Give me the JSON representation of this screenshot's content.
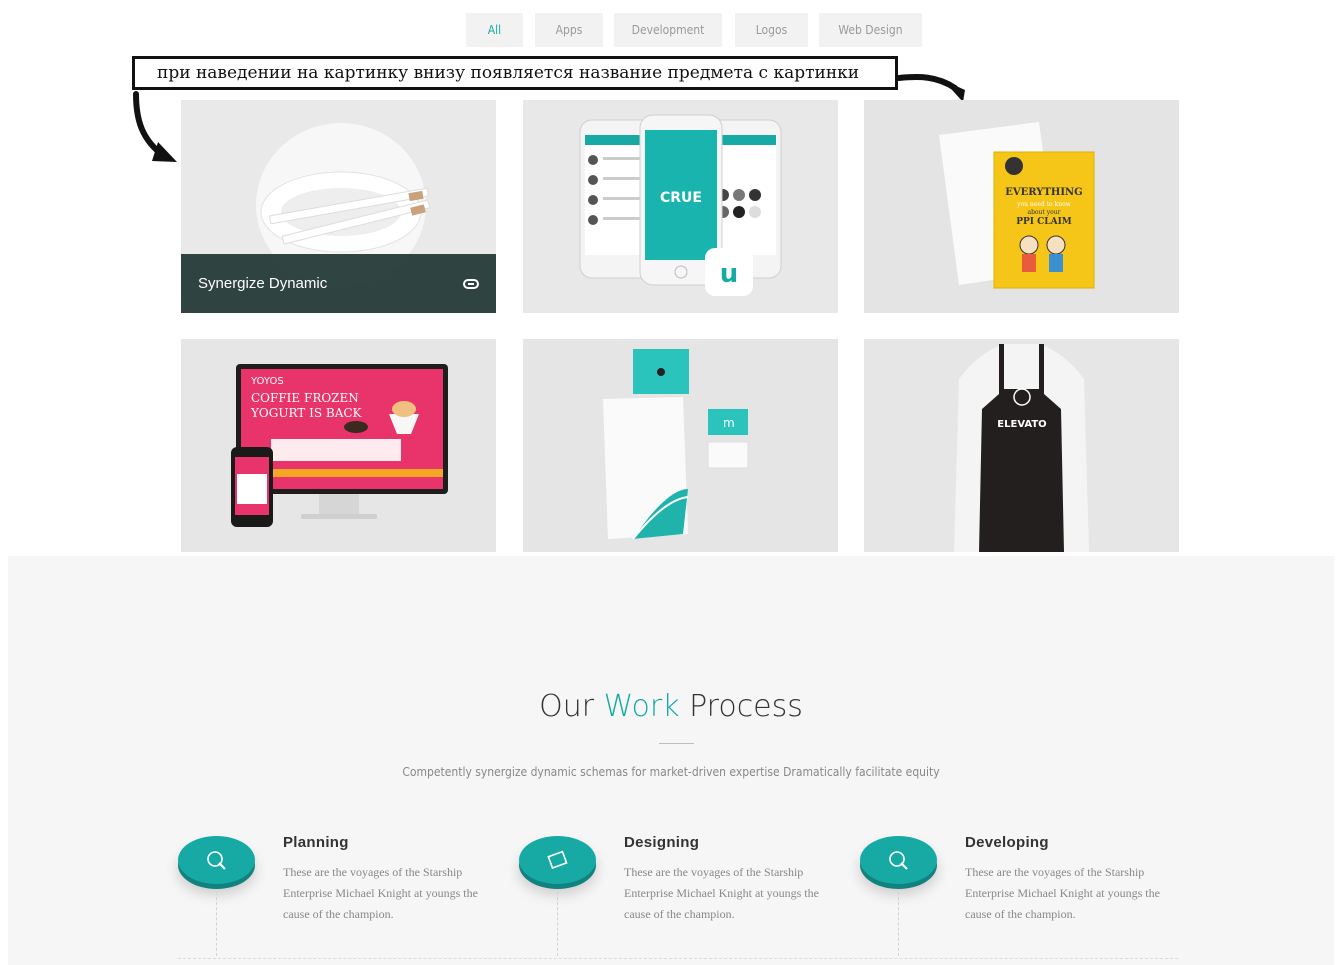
{
  "filters": [
    {
      "label": "All",
      "active": true
    },
    {
      "label": "Apps",
      "active": false
    },
    {
      "label": "Development",
      "active": false
    },
    {
      "label": "Logos",
      "active": false
    },
    {
      "label": "Web Design",
      "active": false
    }
  ],
  "annotation": {
    "text": "при наведении на картинку внизу появляется название предмета с картинки"
  },
  "portfolio": {
    "hover_caption": "Synergize Dynamic",
    "items": [
      {
        "image": "pencils-in-white-bowl",
        "hovered": true
      },
      {
        "image": "crue-mobile-app-phones"
      },
      {
        "image": "everything-poster-envelope",
        "poster_lines": [
          "EVERYTHING",
          "you need to know",
          "about your",
          "PPI CLAIM"
        ]
      },
      {
        "image": "yoyo-website-monitor-phone",
        "screen_lines": [
          "YOYOS",
          "COFFIE FROZEN",
          "YOGURT IS BACK"
        ]
      },
      {
        "image": "stationery-envelope-cards"
      },
      {
        "image": "elevato-apron",
        "apron_text": "ELEVATO"
      }
    ],
    "app_brand": "CRUE"
  },
  "process": {
    "title_before": "Our ",
    "title_accent": "Work",
    "title_after": " Process",
    "subtitle": "Competently synergize dynamic schemas for market-driven expertise Dramatically facilitate equity",
    "steps": [
      {
        "title": "Planning",
        "icon": "lightbulb-icon",
        "text": "These are the voyages of the Starship Enterprise Michael Knight at youngs the cause of the champion."
      },
      {
        "title": "Designing",
        "icon": "design-icon",
        "text": "These are the voyages of the Starship Enterprise Michael Knight at youngs the cause of the champion."
      },
      {
        "title": "Developing",
        "icon": "lightbulb-icon",
        "text": "These are the voyages of the Starship Enterprise Michael Knight at youngs the cause of the champion."
      }
    ]
  },
  "colors": {
    "accent": "#17aaa5",
    "caption_bg": "#1e3432",
    "tile_bg": "#e7e7e7"
  }
}
